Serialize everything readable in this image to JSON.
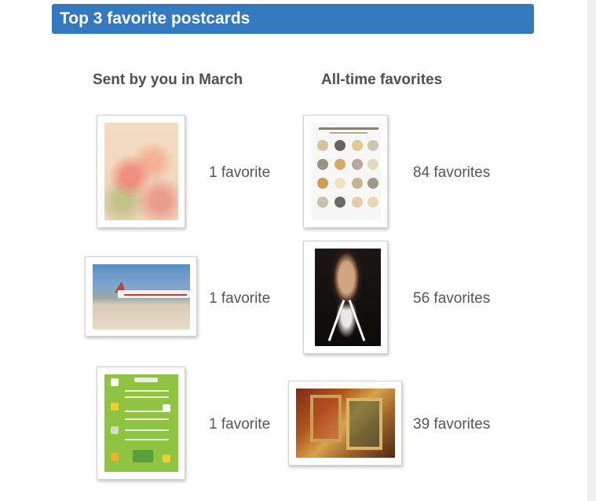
{
  "header": {
    "title": "Top 3 favorite postcards"
  },
  "columns": {
    "sent": {
      "title": "Sent by you in March",
      "items": [
        {
          "count": "1 favorite"
        },
        {
          "count": "1 favorite"
        },
        {
          "count": "1 favorite"
        }
      ]
    },
    "alltime": {
      "title": "All-time favorites",
      "items": [
        {
          "count": "84 favorites"
        },
        {
          "count": "56 favorites"
        },
        {
          "count": "39 favorites"
        }
      ]
    }
  },
  "colors": {
    "header_bg": "#3478c0",
    "header_text": "#ffffff",
    "text": "#444444"
  }
}
